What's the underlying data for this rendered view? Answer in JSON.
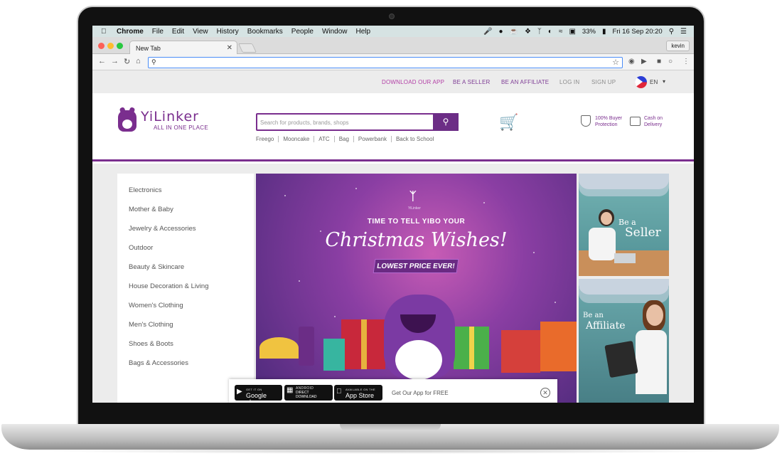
{
  "menubar": {
    "app": "Chrome",
    "menus": [
      "File",
      "Edit",
      "View",
      "History",
      "Bookmarks",
      "People",
      "Window",
      "Help"
    ],
    "battery": "33%",
    "clock": "Fri 16 Sep  20:20"
  },
  "browser": {
    "tab_title": "New Tab",
    "profile": "kevin",
    "address_value": ""
  },
  "site": {
    "top_links": {
      "download_app": "DOWNLOAD OUR APP",
      "be_seller": "BE A SELLER",
      "be_affiliate": "BE AN AFFILIATE",
      "login": "LOG IN",
      "signup": "SIGN UP",
      "language": "EN"
    },
    "logo": {
      "name": "YiLinker",
      "tagline": "ALL IN ONE PLACE"
    },
    "search": {
      "placeholder": "Search for products, brands, shops"
    },
    "popular": [
      "Freego",
      "Mooncake",
      "ATC",
      "Bag",
      "Powerbank",
      "Back to School"
    ],
    "badges": {
      "buyer_protection": [
        "100% Buyer",
        "Protection"
      ],
      "cod": [
        "Cash on",
        "Delivery"
      ]
    },
    "categories": [
      "Electronics",
      "Mother & Baby",
      "Jewelry & Accessories",
      "Outdoor",
      "Beauty & Skincare",
      "House Decoration & Living",
      "Women's Clothing",
      "Men's Clothing",
      "Shoes & Boots",
      "Bags & Accessories"
    ],
    "banner": {
      "brand": "YiLinker",
      "line1": "TIME TO TELL YIBO YOUR",
      "line2": "Christmas Wishes!",
      "ribbon": "LOWEST PRICE EVER!"
    },
    "side_banners": {
      "seller": [
        "Be a",
        "Seller"
      ],
      "affiliate": [
        "Be an",
        "Affiliate"
      ]
    },
    "app_bar": {
      "google_play_small": "GET IT ON",
      "google_play": "Google play",
      "android_small": "ANDROID",
      "android": "DIRECT DOWNLOAD",
      "app_store_small": "AVAILABLE ON THE",
      "app_store": "App Store",
      "text": "Get Our App for FREE"
    }
  },
  "colors": {
    "brand_purple": "#7a2e8e",
    "link_pink": "#b23ea6"
  },
  "dock_icons": [
    "finder-icon",
    "skype-icon",
    "preview-icon",
    "stickies-icon",
    "terminal-icon",
    "chrome-icon",
    "firefox-icon",
    "atom-icon",
    "inkscape-icon",
    "redis-icon",
    "robomongo-icon",
    "appstore-icon",
    "flickr-icon",
    "notes-icon",
    "flickr2-icon",
    "kindle-icon",
    "photoshop-icon",
    "downloads-icon",
    "trash-icon"
  ]
}
